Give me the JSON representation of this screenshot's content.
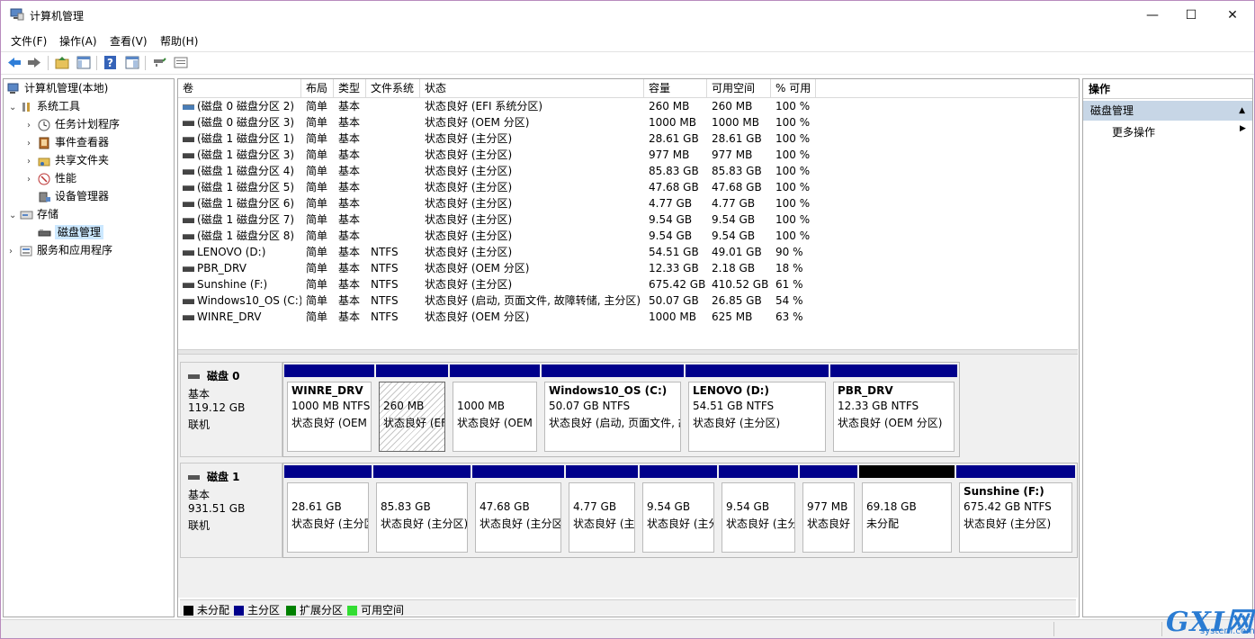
{
  "window": {
    "title": "计算机管理",
    "minimize": "—",
    "maximize": "☐",
    "close": "✕"
  },
  "menu": [
    "文件(F)",
    "操作(A)",
    "查看(V)",
    "帮助(H)"
  ],
  "tree": {
    "root": "计算机管理(本地)",
    "system_tools": "系统工具",
    "task_scheduler": "任务计划程序",
    "event_viewer": "事件查看器",
    "shared_folders": "共享文件夹",
    "performance": "性能",
    "device_manager": "设备管理器",
    "storage": "存储",
    "disk_management": "磁盘管理",
    "services_apps": "服务和应用程序"
  },
  "columns": [
    "卷",
    "布局",
    "类型",
    "文件系统",
    "状态",
    "容量",
    "可用空间",
    "% 可用"
  ],
  "volumes": [
    {
      "name": "(磁盘 0 磁盘分区 2)",
      "layout": "简单",
      "type": "基本",
      "fs": "",
      "status": "状态良好 (EFI 系统分区)",
      "capacity": "260 MB",
      "free": "260 MB",
      "pct": "100 %"
    },
    {
      "name": "(磁盘 0 磁盘分区 3)",
      "layout": "简单",
      "type": "基本",
      "fs": "",
      "status": "状态良好 (OEM 分区)",
      "capacity": "1000 MB",
      "free": "1000 MB",
      "pct": "100 %"
    },
    {
      "name": "(磁盘 1 磁盘分区 1)",
      "layout": "简单",
      "type": "基本",
      "fs": "",
      "status": "状态良好 (主分区)",
      "capacity": "28.61 GB",
      "free": "28.61 GB",
      "pct": "100 %"
    },
    {
      "name": "(磁盘 1 磁盘分区 3)",
      "layout": "简单",
      "type": "基本",
      "fs": "",
      "status": "状态良好 (主分区)",
      "capacity": "977 MB",
      "free": "977 MB",
      "pct": "100 %"
    },
    {
      "name": "(磁盘 1 磁盘分区 4)",
      "layout": "简单",
      "type": "基本",
      "fs": "",
      "status": "状态良好 (主分区)",
      "capacity": "85.83 GB",
      "free": "85.83 GB",
      "pct": "100 %"
    },
    {
      "name": "(磁盘 1 磁盘分区 5)",
      "layout": "简单",
      "type": "基本",
      "fs": "",
      "status": "状态良好 (主分区)",
      "capacity": "47.68 GB",
      "free": "47.68 GB",
      "pct": "100 %"
    },
    {
      "name": "(磁盘 1 磁盘分区 6)",
      "layout": "简单",
      "type": "基本",
      "fs": "",
      "status": "状态良好 (主分区)",
      "capacity": "4.77 GB",
      "free": "4.77 GB",
      "pct": "100 %"
    },
    {
      "name": "(磁盘 1 磁盘分区 7)",
      "layout": "简单",
      "type": "基本",
      "fs": "",
      "status": "状态良好 (主分区)",
      "capacity": "9.54 GB",
      "free": "9.54 GB",
      "pct": "100 %"
    },
    {
      "name": "(磁盘 1 磁盘分区 8)",
      "layout": "简单",
      "type": "基本",
      "fs": "",
      "status": "状态良好 (主分区)",
      "capacity": "9.54 GB",
      "free": "9.54 GB",
      "pct": "100 %"
    },
    {
      "name": "LENOVO (D:)",
      "layout": "简单",
      "type": "基本",
      "fs": "NTFS",
      "status": "状态良好 (主分区)",
      "capacity": "54.51 GB",
      "free": "49.01 GB",
      "pct": "90 %"
    },
    {
      "name": "PBR_DRV",
      "layout": "简单",
      "type": "基本",
      "fs": "NTFS",
      "status": "状态良好 (OEM 分区)",
      "capacity": "12.33 GB",
      "free": "2.18 GB",
      "pct": "18 %"
    },
    {
      "name": "Sunshine (F:)",
      "layout": "简单",
      "type": "基本",
      "fs": "NTFS",
      "status": "状态良好 (主分区)",
      "capacity": "675.42 GB",
      "free": "410.52 GB",
      "pct": "61 %"
    },
    {
      "name": "Windows10_OS (C:)",
      "layout": "简单",
      "type": "基本",
      "fs": "NTFS",
      "status": "状态良好 (启动, 页面文件, 故障转储, 主分区)",
      "capacity": "50.07 GB",
      "free": "26.85 GB",
      "pct": "54 %"
    },
    {
      "name": "WINRE_DRV",
      "layout": "简单",
      "type": "基本",
      "fs": "NTFS",
      "status": "状态良好 (OEM 分区)",
      "capacity": "1000 MB",
      "free": "625 MB",
      "pct": "63 %"
    }
  ],
  "disk0": {
    "name": "磁盘 0",
    "kind": "基本",
    "size": "119.12 GB",
    "state": "联机",
    "partitions": [
      {
        "title": "WINRE_DRV",
        "size": "1000 MB NTFS",
        "status": "状态良好 (OEM"
      },
      {
        "title": "",
        "size": "260 MB",
        "status": "状态良好 (EF"
      },
      {
        "title": "",
        "size": "1000 MB",
        "status": "状态良好 (OEM"
      },
      {
        "title": "Windows10_OS  (C:)",
        "size": "50.07 GB NTFS",
        "status": "状态良好 (启动, 页面文件, 故"
      },
      {
        "title": "LENOVO  (D:)",
        "size": "54.51 GB NTFS",
        "status": "状态良好 (主分区)"
      },
      {
        "title": "PBR_DRV",
        "size": "12.33 GB NTFS",
        "status": "状态良好 (OEM 分区)"
      }
    ]
  },
  "disk1": {
    "name": "磁盘 1",
    "kind": "基本",
    "size": "931.51 GB",
    "state": "联机",
    "partitions": [
      {
        "title": "",
        "size": "28.61 GB",
        "status": "状态良好 (主分区)"
      },
      {
        "title": "",
        "size": "85.83 GB",
        "status": "状态良好 (主分区)"
      },
      {
        "title": "",
        "size": "47.68 GB",
        "status": "状态良好 (主分区)"
      },
      {
        "title": "",
        "size": "4.77 GB",
        "status": "状态良好 (主分区)"
      },
      {
        "title": "",
        "size": "9.54 GB",
        "status": "状态良好 (主分区)"
      },
      {
        "title": "",
        "size": "9.54 GB",
        "status": "状态良好 (主分区)"
      },
      {
        "title": "",
        "size": "977 MB",
        "status": "状态良好"
      },
      {
        "title": "",
        "size": "69.18 GB",
        "status": "未分配"
      },
      {
        "title": "Sunshine  (F:)",
        "size": "675.42 GB NTFS",
        "status": "状态良好 (主分区)"
      }
    ]
  },
  "legend": [
    {
      "label": "未分配",
      "color": "#000000"
    },
    {
      "label": "主分区",
      "color": "#00008b"
    },
    {
      "label": "扩展分区",
      "color": "#008000"
    },
    {
      "label": "可用空间",
      "color": "#33dd33"
    }
  ],
  "actions": {
    "header": "操作",
    "selected": "磁盘管理",
    "more": "更多操作"
  },
  "watermark": {
    "logo": "GXI网",
    "site": "system.com"
  },
  "colors": {
    "primary_partition": "#00008b",
    "selection": "#cce8ff",
    "action_selected": "#c7d6e6"
  }
}
